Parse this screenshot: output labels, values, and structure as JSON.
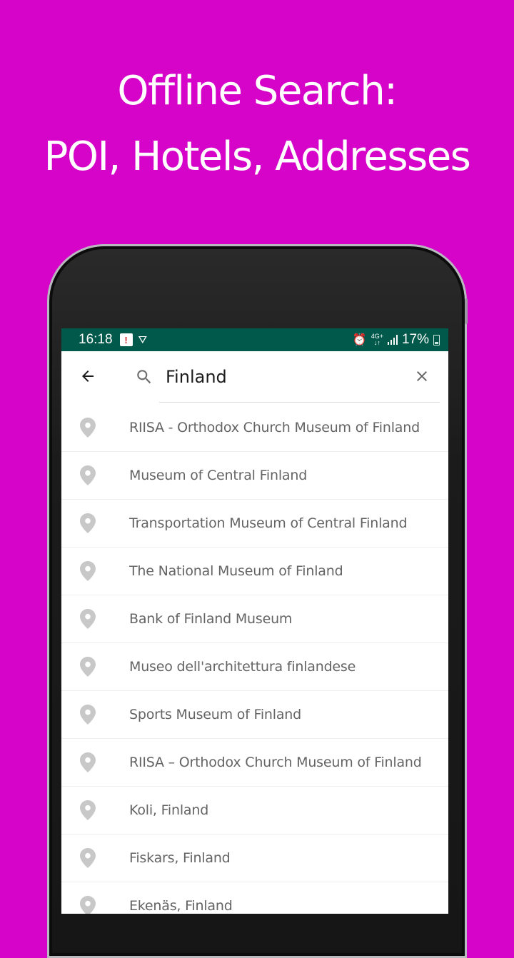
{
  "promo": {
    "line1": "Offline Search:",
    "line2": "POI, Hotels, Addresses",
    "background_color": "#d603c8"
  },
  "status_bar": {
    "time": "16:18",
    "network_label_top": "4G+",
    "network_label_bottom": "↓↑",
    "battery": "17%",
    "color": "#00594a"
  },
  "search": {
    "back_icon": "arrow-left-icon",
    "search_icon": "magnifier-icon",
    "query": "Finland",
    "clear_icon": "close-icon"
  },
  "results": [
    {
      "icon": "map-pin-icon",
      "label": "RIISA - Orthodox Church Museum of Finland"
    },
    {
      "icon": "map-pin-icon",
      "label": "Museum of Central Finland"
    },
    {
      "icon": "map-pin-icon",
      "label": "Transportation Museum of Central Finland"
    },
    {
      "icon": "map-pin-icon",
      "label": "The National Museum of Finland"
    },
    {
      "icon": "map-pin-icon",
      "label": "Bank of Finland Museum"
    },
    {
      "icon": "map-pin-icon",
      "label": "Museo dell'architettura finlandese"
    },
    {
      "icon": "map-pin-icon",
      "label": "Sports Museum of Finland"
    },
    {
      "icon": "map-pin-icon",
      "label": "RIISA – Orthodox Church Museum of Finland"
    },
    {
      "icon": "map-pin-icon",
      "label": "Koli, Finland"
    },
    {
      "icon": "map-pin-icon",
      "label": "Fiskars, Finland"
    },
    {
      "icon": "map-pin-icon",
      "label": "Ekenäs, Finland"
    }
  ]
}
